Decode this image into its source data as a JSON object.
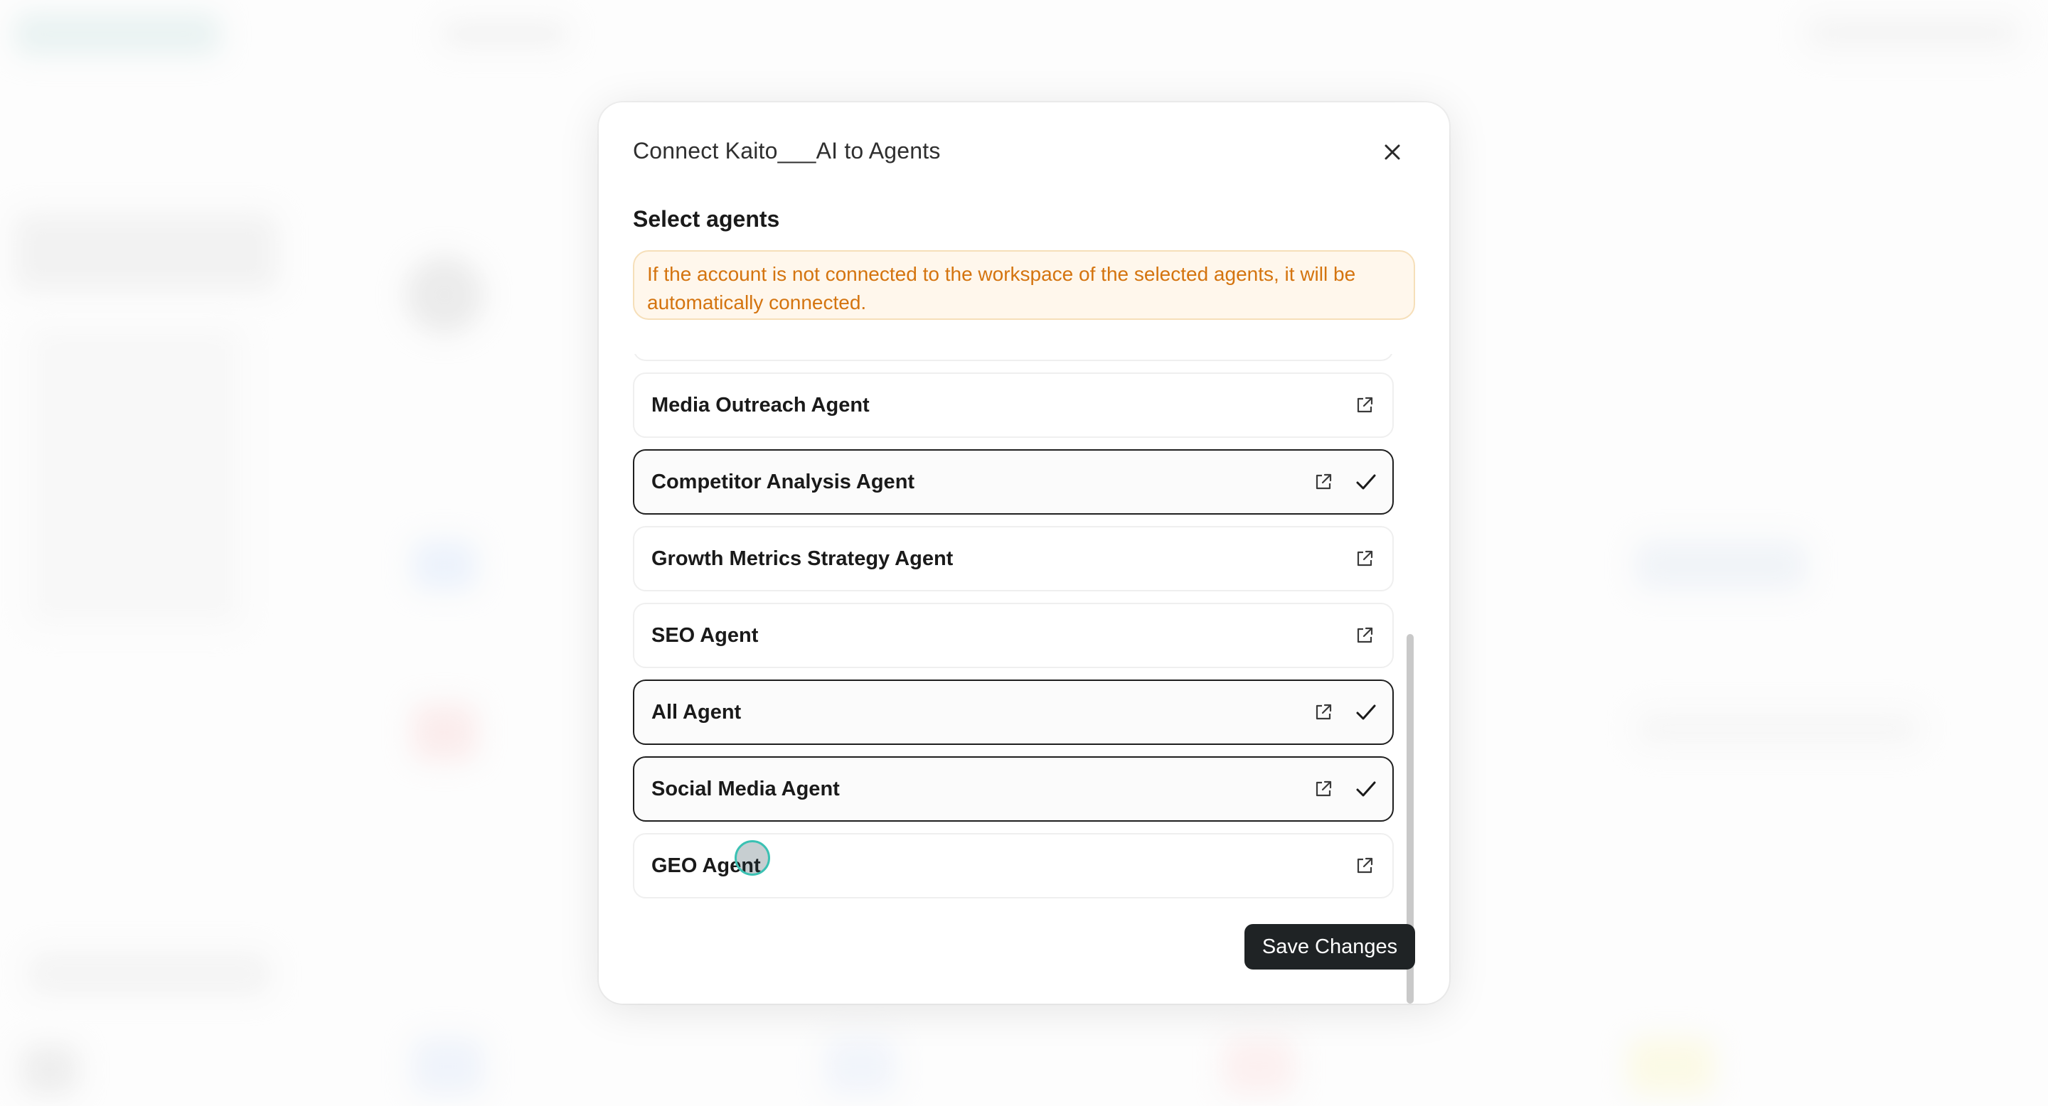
{
  "modal": {
    "title": "Connect Kaito___AI to Agents",
    "section_title": "Select agents",
    "notice": "If the account is not connected to the workspace of the selected agents, it will be automatically connected.",
    "save_label": "Save Changes"
  },
  "agents": [
    {
      "name": "Media Outreach Agent",
      "selected": false
    },
    {
      "name": "Competitor Analysis Agent",
      "selected": true
    },
    {
      "name": "Growth Metrics Strategy Agent",
      "selected": false
    },
    {
      "name": "SEO Agent",
      "selected": false
    },
    {
      "name": "All Agent",
      "selected": true
    },
    {
      "name": "Social Media Agent",
      "selected": true
    },
    {
      "name": "GEO Agent",
      "selected": false
    }
  ],
  "icons": {
    "close": "close-icon",
    "external": "external-link-icon",
    "check": "check-icon"
  },
  "colors": {
    "notice_text": "#d4740f",
    "notice_bg": "#fff7ec",
    "button_bg": "#1f2325",
    "selected_border": "#1f1f1f"
  }
}
